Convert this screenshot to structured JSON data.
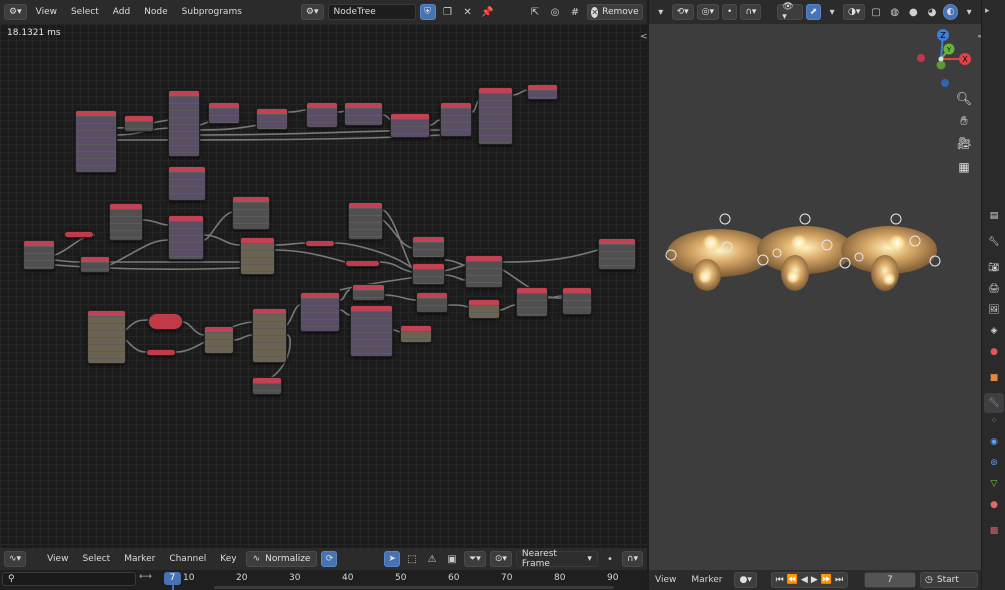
{
  "node_editor": {
    "menus": [
      "View",
      "Select",
      "Add",
      "Node",
      "Subprograms"
    ],
    "tree_name": "NodeTree",
    "remove_label": "Remove",
    "timing": "18.1321 ms"
  },
  "timeline": {
    "menus": [
      "View",
      "Select",
      "Marker",
      "Channel",
      "Key"
    ],
    "normalize_label": "Normalize",
    "interpolation": "Nearest Frame",
    "current_frame_badge": "7",
    "ticks": [
      "10",
      "20",
      "30",
      "40",
      "50",
      "60",
      "70",
      "80",
      "90"
    ]
  },
  "viewport": {
    "gizmo_axes": {
      "x": "X",
      "y": "Y",
      "z": "Z"
    },
    "bottom_menus": [
      "View",
      "Marker"
    ],
    "frame_value": "7",
    "start_label": "Start"
  },
  "colors": {
    "accent": "#4772b3",
    "node_header_red": "#c24152",
    "axis_x": "#e0424a",
    "axis_y": "#6bb43a",
    "axis_z": "#3d7fd8"
  }
}
